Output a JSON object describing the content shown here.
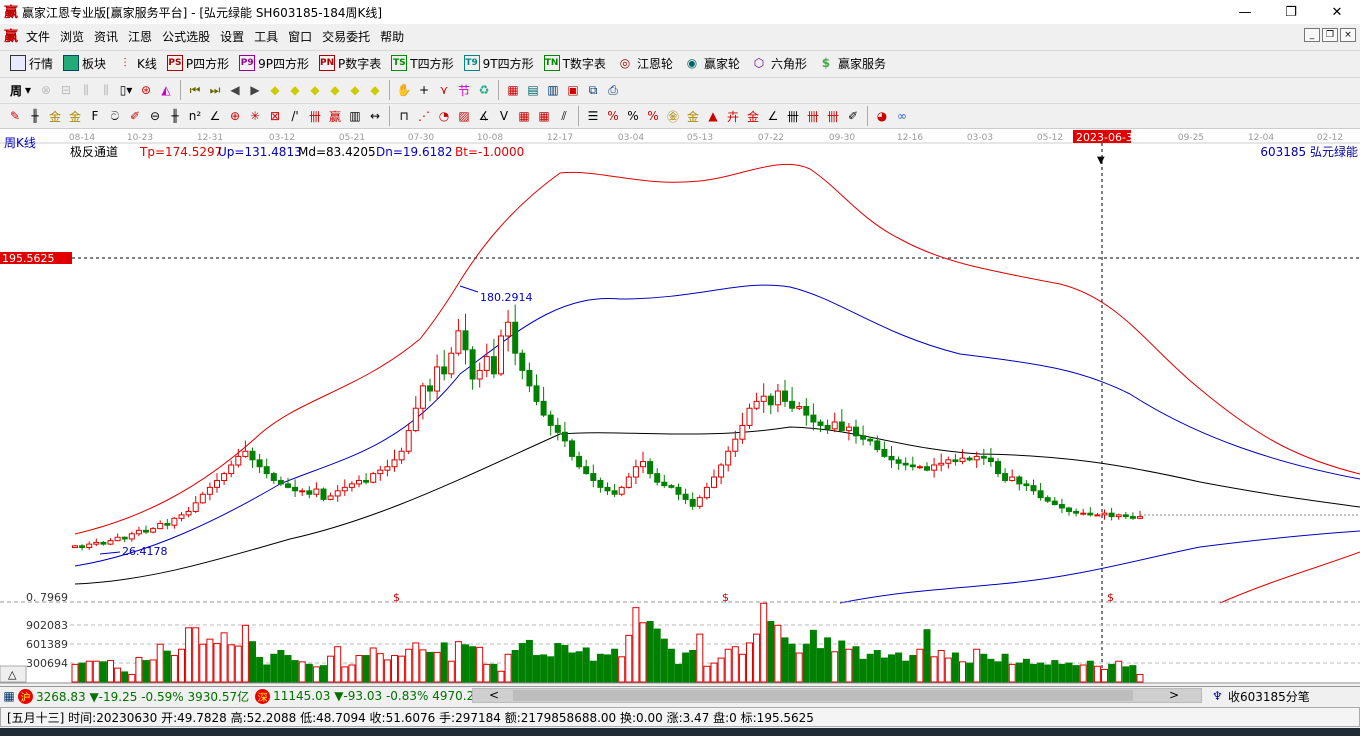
{
  "window": {
    "title": "赢家江恩专业版[赢家服务平台] - [弘元绿能  SH603185-184周K线]",
    "logo": "赢",
    "minimize": "—",
    "restore": "❐",
    "close": "✕"
  },
  "menu": [
    "文件",
    "浏览",
    "资讯",
    "江恩",
    "公式选股",
    "设置",
    "工具",
    "窗口",
    "交易委托",
    "帮助"
  ],
  "toolbar1": [
    {
      "label": "行情",
      "icon": "table-icon"
    },
    {
      "label": "板块",
      "icon": "blocks-icon"
    },
    {
      "label": "K线",
      "icon": "kline-icon"
    },
    {
      "label": "P四方形",
      "icon": "PS"
    },
    {
      "label": "9P四方形",
      "icon": "P9"
    },
    {
      "label": "P数字表",
      "icon": "PN"
    },
    {
      "label": "T四方形",
      "icon": "TS"
    },
    {
      "label": "9T四方形",
      "icon": "T9"
    },
    {
      "label": "T数字表",
      "icon": "TN"
    },
    {
      "label": "江恩轮",
      "icon": "wheel-icon"
    },
    {
      "label": "赢家轮",
      "icon": "wheel2-icon"
    },
    {
      "label": "六角形",
      "icon": "hexagon-icon"
    },
    {
      "label": "赢家服务",
      "icon": "dollar-icon"
    }
  ],
  "period_button": "周",
  "chart": {
    "panel_label": "周K线",
    "indicator": {
      "name": "极反通道",
      "tp": "Tp=174.5297",
      "up": "Up=131.4813",
      "md": "Md=83.4205",
      "dn": "Dn=19.6182",
      "bt": "Bt=-1.0000"
    },
    "stock": "603185  弘元绿能",
    "date_ticks": [
      "08-14",
      "10-23",
      "12-31",
      "03-12",
      "05-21",
      "07-30",
      "10-08",
      "12-17",
      "03-04",
      "05-13",
      "07-22",
      "09-30",
      "12-16",
      "03-03",
      "05-12",
      "09-25",
      "12-04",
      "02-12"
    ],
    "cursor_date": "2023-06-30",
    "cursor_price": "195.5625",
    "high_label": "180.2914",
    "low_label": "26.4178",
    "vol_ticks": [
      "0. 7969",
      "902083",
      "601389",
      "300694"
    ],
    "dollar_mark": "$",
    "collapse_button": "△"
  },
  "chart_data": {
    "type": "candlestick",
    "period": "weekly",
    "closes": [
      28,
      27,
      29,
      30,
      29,
      31,
      33,
      32,
      35,
      37,
      36,
      38,
      41,
      40,
      44,
      46,
      48,
      53,
      58,
      62,
      66,
      70,
      75,
      80,
      83,
      78,
      74,
      70,
      66,
      64,
      62,
      60,
      60,
      58,
      61,
      55,
      57,
      60,
      62,
      64,
      66,
      65,
      70,
      72,
      74,
      78,
      83,
      95,
      108,
      121,
      118,
      132,
      128,
      140,
      153,
      142,
      125,
      130,
      138,
      128,
      150,
      158,
      140,
      130,
      121,
      112,
      104,
      98,
      94,
      89,
      80,
      74,
      70,
      66,
      62,
      60,
      58,
      62,
      68,
      74,
      77,
      70,
      65,
      63,
      62,
      58,
      55,
      51,
      56,
      62,
      68,
      75,
      83,
      90,
      98,
      108,
      112,
      115,
      110,
      118,
      112,
      108,
      109,
      104,
      100,
      98,
      96,
      100,
      95,
      97,
      92,
      90,
      89,
      84,
      80,
      78,
      76,
      75,
      74,
      74,
      72,
      75,
      76,
      78,
      77,
      79,
      78,
      80,
      79,
      77,
      70,
      66,
      68,
      64,
      63,
      60,
      56,
      54,
      52,
      50,
      48,
      47,
      47,
      46,
      46,
      47,
      45,
      46,
      45,
      44,
      45
    ],
    "volumes": [
      280,
      300,
      330,
      330,
      320,
      340,
      220,
      160,
      120,
      390,
      340,
      350,
      600,
      490,
      420,
      520,
      860,
      860,
      600,
      680,
      610,
      780,
      590,
      570,
      900,
      640,
      390,
      270,
      440,
      500,
      420,
      340,
      320,
      280,
      240,
      260,
      410,
      560,
      240,
      270,
      420,
      420,
      540,
      450,
      350,
      420,
      410,
      520,
      620,
      510,
      470,
      470,
      620,
      330,
      640,
      590,
      560,
      550,
      280,
      280,
      170,
      440,
      500,
      610,
      660,
      420,
      430,
      400,
      610,
      580,
      460,
      480,
      540,
      330,
      440,
      430,
      520,
      400,
      740,
      1180,
      940,
      960,
      840,
      680,
      520,
      280,
      460,
      500,
      760,
      250,
      300,
      380,
      520,
      560,
      440,
      620,
      760,
      1250,
      960,
      900,
      700,
      600,
      460,
      600,
      820,
      530,
      700,
      480,
      650,
      520,
      560,
      360,
      440,
      500,
      380,
      430,
      460,
      330,
      420,
      520,
      830,
      400,
      500,
      380,
      460,
      320,
      300,
      520,
      440,
      360,
      320,
      440,
      280,
      300,
      360,
      280,
      300,
      270,
      340,
      280,
      300,
      260,
      270,
      330,
      250,
      200,
      280,
      330,
      240,
      260,
      120
    ],
    "vol_unit": "thousand lots (approx.)",
    "price_axis_ref": 195.5625
  },
  "index_bar": {
    "sh": {
      "badge": "沪",
      "value": "3268.83",
      "change": "▼-19.25",
      "pct": "-0.59%",
      "amount": "3930.57亿"
    },
    "sz": {
      "badge": "深",
      "value": "11145.03",
      "change": "▼-93.03",
      "pct": "-0.83%",
      "amount": "4970.20"
    },
    "scroll_left": "<",
    "scroll_right": ">",
    "ticker": "收603185分笔"
  },
  "status": "[五月十三] 时间:20230630 开:49.7828 高:52.2088 低:48.7094 收:51.6076 手:297184 额:2179858688.00 换:0.00 涨:3.47 盘:0 标:195.5625",
  "colors": {
    "up": "#e00000",
    "down": "#008000",
    "tp": "#e00000",
    "up_band": "#0000c0",
    "md": "#000000",
    "dn": "#0000c0"
  }
}
